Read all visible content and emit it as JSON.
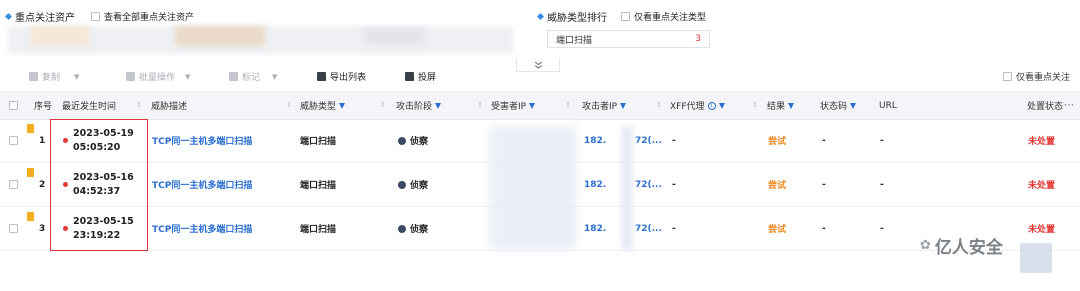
{
  "focus_assets": {
    "title": "重点关注资产",
    "show_all_label": "查看全部重点关注资产"
  },
  "threat_rank": {
    "title": "威胁类型排行",
    "only_focus_label": "仅看重点关注类型",
    "item_label": "端口扫描",
    "item_count": "3"
  },
  "collapse_icon": "double-chevron-down",
  "toolbar": {
    "copy_label": "复制",
    "batch_label": "批量操作",
    "tag_label": "标记",
    "export_label": "导出列表",
    "screen_label": "投屏",
    "only_focus_label": "仅看重点关注"
  },
  "columns": {
    "seq": "序号",
    "time": "最近发生时间",
    "desc": "威胁描述",
    "type": "威胁类型",
    "stage": "攻击阶段",
    "victim": "受害者IP",
    "attacker": "攻击者IP",
    "xff": "XFF代理",
    "result": "结果",
    "status_code": "状态码",
    "url": "URL",
    "handle": "处置状态"
  },
  "more_icon": "ellipsis-icon",
  "rows": [
    {
      "seq": "1",
      "date": "2023-05-19",
      "time": "05:05:20",
      "desc": "TCP同一主机多端口扫描",
      "type": "端口扫描",
      "stage": "侦察",
      "attacker_a": "182.",
      "attacker_b": "72(...",
      "xff": "-",
      "result": "尝试",
      "status_code": "-",
      "url": "-",
      "handle": "未处置"
    },
    {
      "seq": "2",
      "date": "2023-05-16",
      "time": "04:52:37",
      "desc": "TCP同一主机多端口扫描",
      "type": "端口扫描",
      "stage": "侦察",
      "attacker_a": "182.",
      "attacker_b": "72(...",
      "xff": "-",
      "result": "尝试",
      "status_code": "-",
      "url": "-",
      "handle": "未处置"
    },
    {
      "seq": "3",
      "date": "2023-05-15",
      "time": "23:19:22",
      "desc": "TCP同一主机多端口扫描",
      "type": "端口扫描",
      "stage": "侦察",
      "attacker_a": "182.",
      "attacker_b": "72(...",
      "xff": "-",
      "result": "尝试",
      "status_code": "-",
      "url": "-",
      "handle": "未处置"
    }
  ],
  "watermark": {
    "text": "亿人安全"
  },
  "colors": {
    "accent": "#2d6fd0",
    "danger": "#e53935",
    "warning": "#f08a24",
    "highlight_box": "#d9363e"
  }
}
